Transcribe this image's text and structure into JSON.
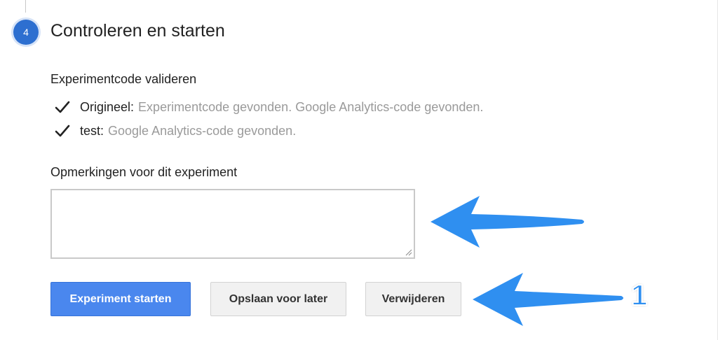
{
  "step": {
    "number": "4",
    "title": "Controleren en starten"
  },
  "validation": {
    "heading": "Experimentcode valideren",
    "items": [
      {
        "label": "Origineel:",
        "detail": "Experimentcode gevonden. Google Analytics-code gevonden."
      },
      {
        "label": "test:",
        "detail": "Google Analytics-code gevonden."
      }
    ]
  },
  "notes": {
    "label": "Opmerkingen voor dit experiment",
    "value": ""
  },
  "buttons": {
    "start": "Experiment starten",
    "save": "Opslaan voor later",
    "delete": "Verwijderen"
  },
  "annotation": {
    "number": "1"
  },
  "colors": {
    "primary": "#4a87ee",
    "step_badge": "#2d6fd0",
    "arrow": "#2f8ff0",
    "muted_text": "#9a9a9a"
  }
}
